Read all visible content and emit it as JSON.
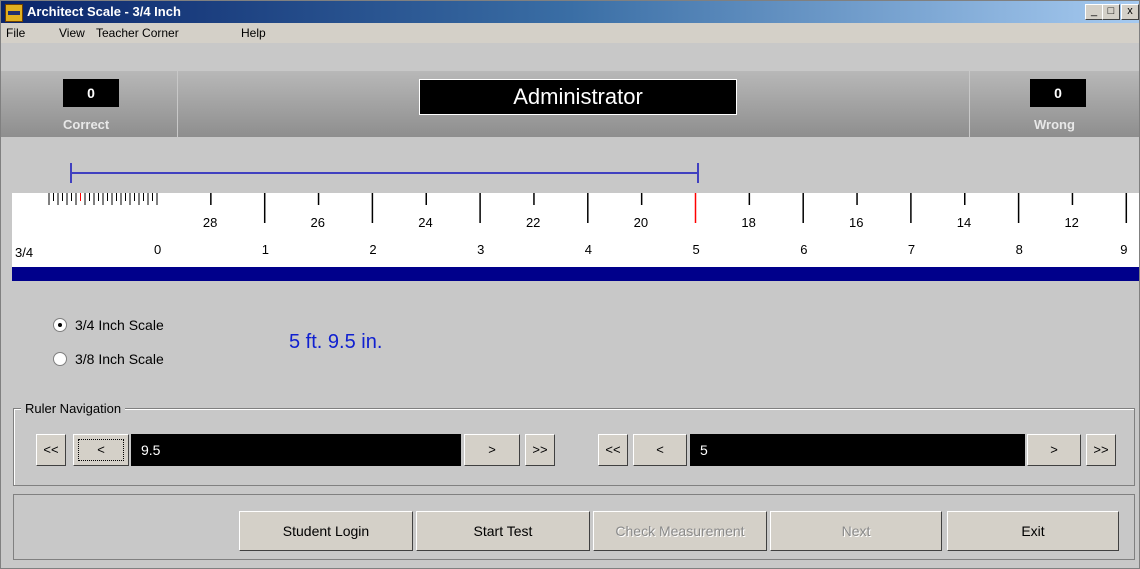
{
  "window": {
    "title": "Architect Scale - 3/4 Inch"
  },
  "title_buttons": {
    "minimize": "_",
    "maximize": "□",
    "close": "x"
  },
  "menu": [
    "File",
    "View",
    "Teacher Corner",
    "Help"
  ],
  "score": {
    "correct_value": "0",
    "correct_label": "Correct",
    "wrong_value": "0",
    "wrong_label": "Wrong"
  },
  "user": "Administrator",
  "ruler": {
    "scale_label": "3/4",
    "top_labels": [
      "28",
      "26",
      "24",
      "22",
      "20",
      "18",
      "16",
      "14",
      "12"
    ],
    "bottom_labels": [
      "0",
      "1",
      "2",
      "3",
      "4",
      "5",
      "6",
      "7",
      "8",
      "9"
    ],
    "marker_color": "#ff0000",
    "line_color": "#4040c0",
    "bar_color": "#00008b"
  },
  "scales": [
    {
      "label": "3/4  Inch Scale",
      "selected": true
    },
    {
      "label": "3/8  Inch Scale",
      "selected": false
    }
  ],
  "measurement": "5 ft. 9.5 in.",
  "navigation": {
    "group_label": "Ruler Navigation",
    "left": {
      "first": "<<",
      "prev": "<",
      "value": "9.5",
      "next": ">",
      "last": ">>"
    },
    "right": {
      "first": "<<",
      "prev": "<",
      "value": "5",
      "next": ">",
      "last": ">>"
    }
  },
  "buttons": {
    "student_login": "Student Login",
    "start_test": "Start Test",
    "check_measurement": "Check Measurement",
    "next": "Next",
    "exit": "Exit"
  }
}
